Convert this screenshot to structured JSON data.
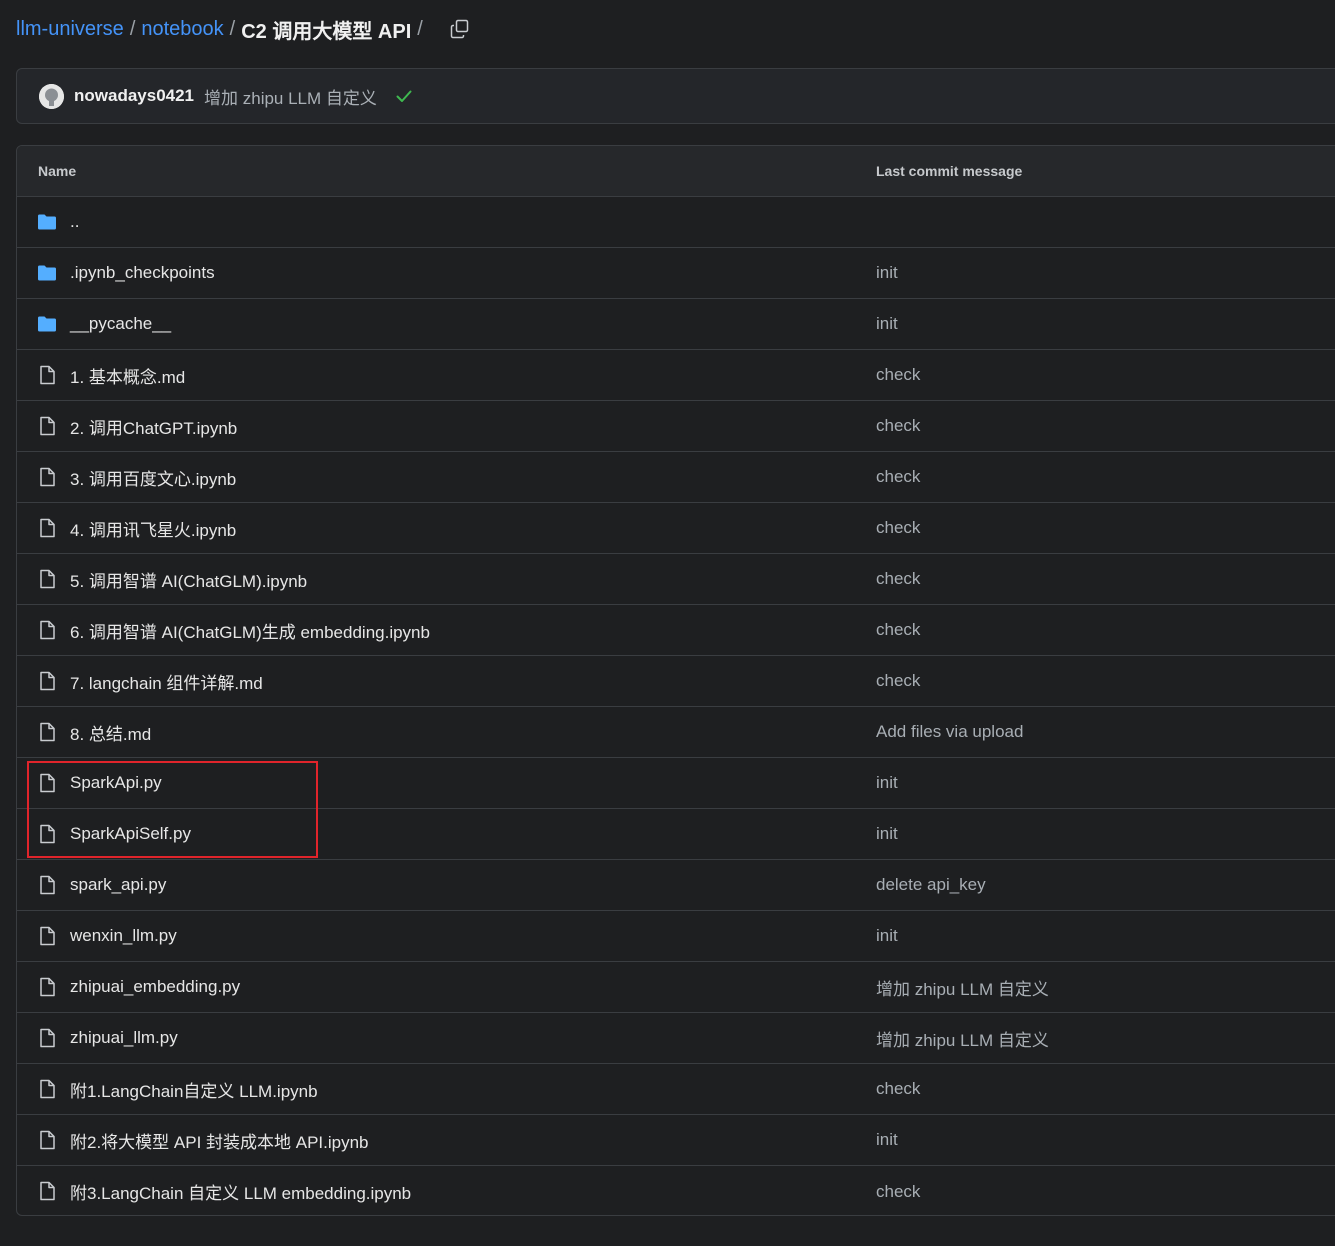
{
  "breadcrumb": {
    "repo": "llm-universe",
    "folder": "notebook",
    "current": "C2 调用大模型 API",
    "separator": "/",
    "copy_icon": "copy-icon"
  },
  "latest_commit": {
    "author": "nowadays0421",
    "message": "增加 zhipu LLM 自定义",
    "status": "success",
    "status_color": "#3fb950"
  },
  "table": {
    "header_name": "Name",
    "header_message": "Last commit message",
    "rows": [
      {
        "type": "folder",
        "name": "..",
        "message": ""
      },
      {
        "type": "folder",
        "name": ".ipynb_checkpoints",
        "message": "init"
      },
      {
        "type": "folder",
        "name": "__pycache__",
        "message": "init"
      },
      {
        "type": "file",
        "name": "1. 基本概念.md",
        "message": "check"
      },
      {
        "type": "file",
        "name": "2. 调用ChatGPT.ipynb",
        "message": "check"
      },
      {
        "type": "file",
        "name": "3. 调用百度文心.ipynb",
        "message": "check"
      },
      {
        "type": "file",
        "name": "4. 调用讯飞星火.ipynb",
        "message": "check"
      },
      {
        "type": "file",
        "name": "5. 调用智谱 AI(ChatGLM).ipynb",
        "message": "check"
      },
      {
        "type": "file",
        "name": "6. 调用智谱 AI(ChatGLM)生成 embedding.ipynb",
        "message": "check"
      },
      {
        "type": "file",
        "name": "7. langchain 组件详解.md",
        "message": "check"
      },
      {
        "type": "file",
        "name": "8. 总结.md",
        "message": "Add files via upload"
      },
      {
        "type": "file",
        "name": "SparkApi.py",
        "message": "init"
      },
      {
        "type": "file",
        "name": "SparkApiSelf.py",
        "message": "init"
      },
      {
        "type": "file",
        "name": "spark_api.py",
        "message": "delete api_key"
      },
      {
        "type": "file",
        "name": "wenxin_llm.py",
        "message": "init"
      },
      {
        "type": "file",
        "name": "zhipuai_embedding.py",
        "message": "增加 zhipu LLM 自定义"
      },
      {
        "type": "file",
        "name": "zhipuai_llm.py",
        "message": "增加 zhipu LLM 自定义"
      },
      {
        "type": "file",
        "name": "附1.LangChain自定义 LLM.ipynb",
        "message": "check"
      },
      {
        "type": "file",
        "name": "附2.将大模型 API 封装成本地 API.ipynb",
        "message": "init"
      },
      {
        "type": "file",
        "name": "附3.LangChain 自定义 LLM embedding.ipynb",
        "message": "check"
      }
    ]
  },
  "colors": {
    "folder_icon": "#54aeff",
    "file_icon": "#c9ccd0",
    "link": "#4493f8",
    "highlight": "#e0242b"
  }
}
